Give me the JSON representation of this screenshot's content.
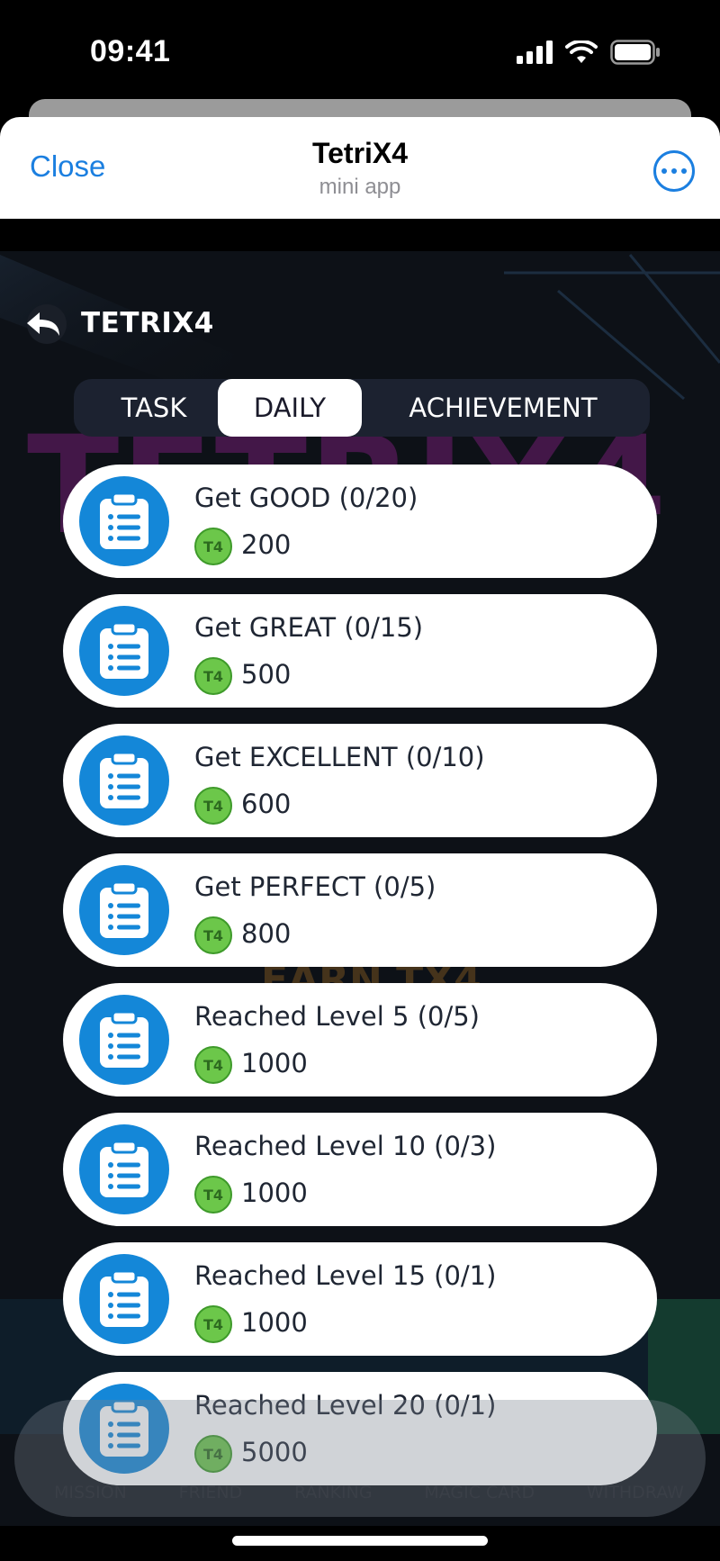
{
  "status_bar": {
    "time": "09:41"
  },
  "header": {
    "close_label": "Close",
    "title": "TetriX4",
    "subtitle": "mini app"
  },
  "game": {
    "brand": "TETRIX4",
    "tabs": [
      {
        "label": "TASK",
        "active": false
      },
      {
        "label": "DAILY",
        "active": true
      },
      {
        "label": "ACHIEVEMENT",
        "active": false
      }
    ],
    "tasks": [
      {
        "title": "Get GOOD (0/20)",
        "reward": "200"
      },
      {
        "title": "Get GREAT (0/15)",
        "reward": "500"
      },
      {
        "title": "Get EXCELLENT (0/10)",
        "reward": "600"
      },
      {
        "title": "Get PERFECT (0/5)",
        "reward": "800"
      },
      {
        "title": "Reached Level 5 (0/5)",
        "reward": "1000"
      },
      {
        "title": "Reached Level 10 (0/3)",
        "reward": "1000"
      },
      {
        "title": "Reached Level 15 (0/1)",
        "reward": "1000"
      },
      {
        "title": "Reached Level 20 (0/1)",
        "reward": "5000"
      }
    ],
    "coin_label": "T4",
    "bottom_nav": [
      "MISSION",
      "FRIEND",
      "RANKING",
      "MAGIC CARD",
      "WITHDRAW"
    ]
  },
  "colors": {
    "accent_blue": "#1b7fe0",
    "task_icon_blue": "#1487d8",
    "coin_green": "#6cc74a"
  }
}
